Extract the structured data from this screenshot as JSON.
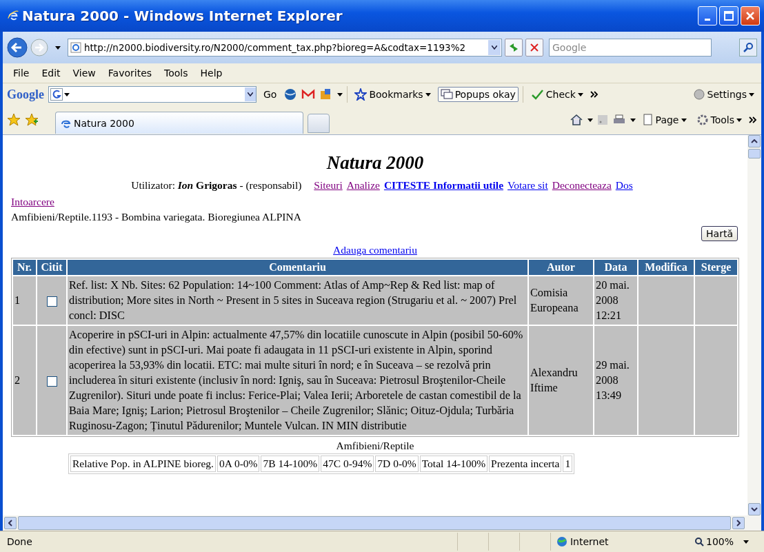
{
  "window": {
    "title": "Natura 2000 - Windows Internet Explorer"
  },
  "address": {
    "url": "http://n2000.biodiversity.ro/N2000/comment_tax.php?bioreg=A&codtax=1193%2"
  },
  "search": {
    "placeholder": "Google"
  },
  "menu": [
    "File",
    "Edit",
    "View",
    "Favorites",
    "Tools",
    "Help"
  ],
  "google_toolbar": {
    "logo": "Google",
    "go": "Go",
    "bookmarks": "Bookmarks",
    "popups": "Popups okay",
    "check": "Check",
    "settings": "Settings"
  },
  "tabs": [
    {
      "label": "Natura 2000",
      "selected": true
    }
  ],
  "command_bar": {
    "page": "Page",
    "tools": "Tools"
  },
  "page": {
    "title": "Natura 2000",
    "user": {
      "label": "Utilizator:",
      "first_name": "Ion",
      "last_name": "Grigoras",
      "role": "- (responsabil)"
    },
    "links": [
      {
        "text": "Siteuri",
        "visited": true,
        "bold": false
      },
      {
        "text": "Analize",
        "visited": true,
        "bold": false
      },
      {
        "text": "CITESTE Informatii utile",
        "visited": false,
        "bold": true
      },
      {
        "text": "Votare sit",
        "visited": false,
        "bold": false
      },
      {
        "text": "Deconecteaza",
        "visited": true,
        "bold": false
      },
      {
        "text": "Dos",
        "visited": false,
        "bold": false
      },
      {
        "text": "Intoarcere",
        "visited": true,
        "bold": false
      }
    ],
    "breadcrumb": "Amfibieni/Reptile.1193 - Bombina variegata. Bioregiunea ALPINA",
    "map_button": "Hartă",
    "add_comment": "Adauga comentariu",
    "table": {
      "columns": [
        "Nr.",
        "Citit",
        "Comentariu",
        "Autor",
        "Data",
        "Modifica",
        "Sterge"
      ],
      "rows": [
        {
          "nr": "1",
          "checked": false,
          "comment": "Ref. list: X Nb. Sites: 62 Population: 14~100 Comment: Atlas of Amp~Rep & Red list: map of distribution; More sites in North ~ Present in 5 sites in Suceava region (Strugariu et al. ~ 2007) Prel concl: DISC",
          "author": "Comisia Europeana",
          "date": [
            "20 mai.",
            "2008",
            "12:21"
          ]
        },
        {
          "nr": "2",
          "checked": false,
          "comment": "Acoperire in pSCI-uri in Alpin: actualmente 47,57% din locatiile cunoscute in Alpin (posibil 50-60% din efective) sunt in pSCI-uri. Mai poate fi adaugata in 11 pSCI-uri existente in Alpin, sporind acoperirea la 53,93% din locatii. ETC: mai multe situri în nord; e în Suceava – se rezolvă prin includerea în situri existente (inclusiv în nord: Igniş, sau în Suceava: Pietrosul Broştenilor-Cheile Zugrenilor). Situri unde poate fi inclus: Ferice-Plai; Valea Ierii; Arboretele de castan comestibil de la Baia Mare; Igniş; Larion; Pietrosul Broştenilor – Cheile Zugrenilor; Slănic; Oituz-Ojdula; Turbăria Ruginosu-Zagon; Ținutul Pădurenilor; Muntele Vulcan. IN MIN distributie",
          "author": "Alexandru Iftime",
          "date": [
            "29 mai.",
            "2008",
            "13:49"
          ]
        }
      ]
    },
    "summary_caption": "Amfibieni/Reptile",
    "summary": [
      "Relative Pop. in ALPINE bioreg.",
      "0A 0-0%",
      "7B 14-100%",
      "47C 0-94%",
      "7D 0-0%",
      "Total 14-100%",
      "Prezenta incerta",
      "1"
    ]
  },
  "status_bar": {
    "text": "Done",
    "zone": "Internet",
    "zoom": "100%"
  }
}
